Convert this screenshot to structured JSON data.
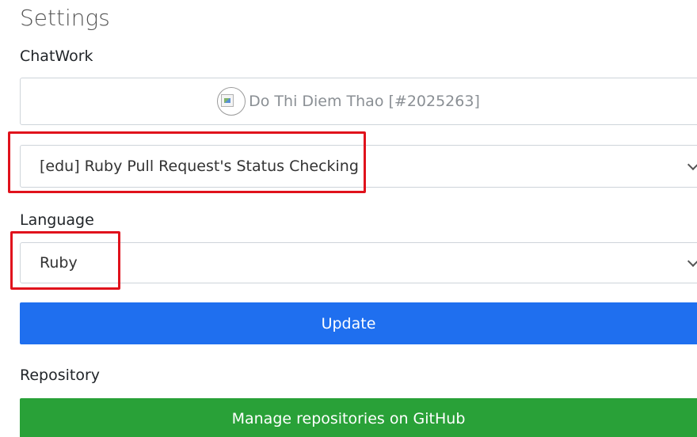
{
  "page": {
    "title": "Settings"
  },
  "chatwork": {
    "label": "ChatWork",
    "account_name": "Do Thi Diem Thao [#2025263]",
    "room_select_value": "[edu] Ruby Pull Request's Status Checking"
  },
  "language": {
    "label": "Language",
    "select_value": "Ruby"
  },
  "update_button": {
    "label": "Update",
    "color": "#1f6fef"
  },
  "repository": {
    "label": "Repository",
    "manage_button_label": "Manage repositories on GitHub",
    "manage_button_color": "#29a138"
  },
  "annotations": {
    "highlight_color": "#e0121c"
  }
}
